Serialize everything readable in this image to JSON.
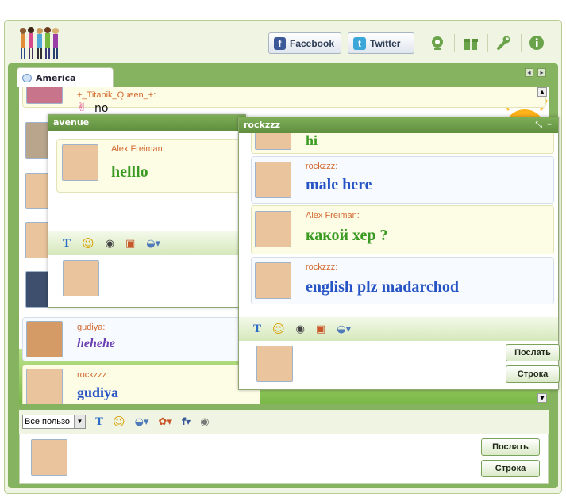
{
  "topbar": {
    "facebook_label": "Facebook",
    "twitter_label": "Twitter"
  },
  "room": {
    "tab_label": "America",
    "partial_top": {
      "nick": "+_Titanik_Queen_+:",
      "text": "no"
    },
    "messages": [
      {
        "nick": "gudiya:",
        "text": "hehehe",
        "color": "#6a3fb0"
      },
      {
        "nick": "rockzzz:",
        "text": "gudiya",
        "color": "#2654c4"
      }
    ]
  },
  "main_input": {
    "select_value": "Все пользо",
    "send_label": "Послать",
    "line_label": "Строка"
  },
  "avenue_window": {
    "title": "avenue",
    "messages": [
      {
        "nick": "Alex Freiman:",
        "text": "helllo",
        "color": "#3a9a22"
      }
    ]
  },
  "rockzzz_window": {
    "title": "rockzzz",
    "partial_top_text": "hi",
    "messages": [
      {
        "nick": "rockzzz:",
        "text": "male here",
        "color": "#2654c4"
      },
      {
        "nick": "Alex Freiman:",
        "text": "какой хер ?",
        "color": "#3a9a22"
      },
      {
        "nick": "rockzzz:",
        "text": "english plz madarchod",
        "color": "#2654c4"
      }
    ],
    "send_label": "Послать",
    "line_label": "Строка"
  },
  "colors": {
    "frame_green": "#86b35f",
    "nick_orange": "#d3692f",
    "panel_bg": "#eff5e2"
  }
}
